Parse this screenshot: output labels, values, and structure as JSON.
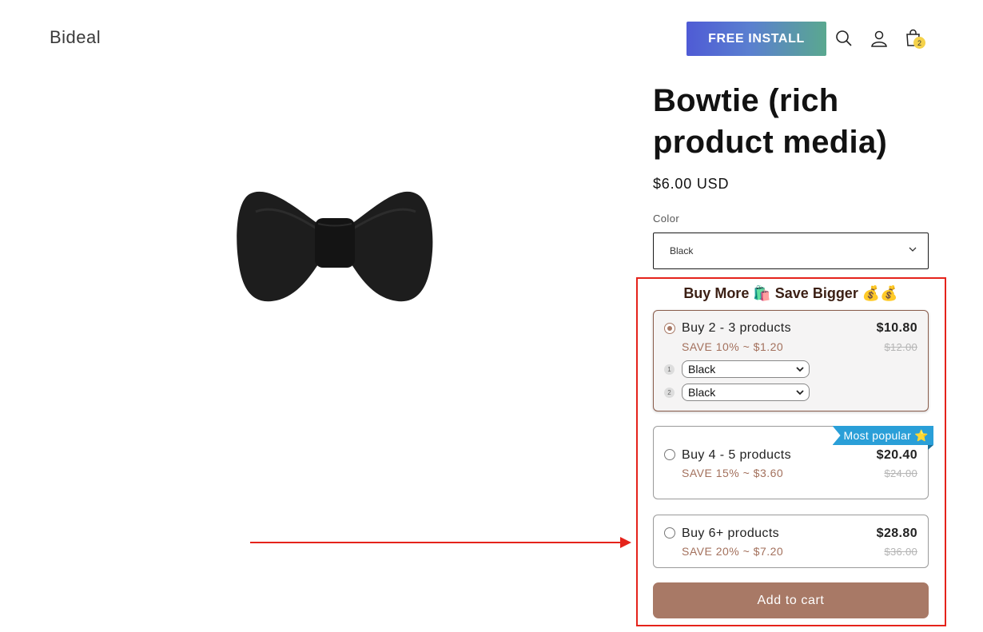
{
  "header": {
    "logo": "Bideal",
    "install_label": "FREE INSTALL",
    "cart_count": "2",
    "icons": [
      "search-icon",
      "account-icon",
      "cart-icon"
    ]
  },
  "product": {
    "title": "Bowtie (rich product media)",
    "price": "$6.00 USD",
    "color_label": "Color",
    "color_value": "Black",
    "image": "black-bowtie"
  },
  "bundle": {
    "heading": "Buy More",
    "heading_mid": "Save Bigger",
    "heading_emoji_1": "🛍️",
    "heading_emoji_2": "💰💰",
    "tiers": [
      {
        "name": "Buy 2 - 3 products",
        "save": "SAVE 10% ~ $1.20",
        "price": "$10.80",
        "compare": "$12.00",
        "selected": true,
        "variants": [
          {
            "num": "1",
            "value": "Black"
          },
          {
            "num": "2",
            "value": "Black"
          }
        ]
      },
      {
        "name": "Buy 4 - 5 products",
        "save": "SAVE 15% ~ $3.60",
        "price": "$20.40",
        "compare": "$24.00",
        "badge": "Most popular ⭐",
        "selected": false
      },
      {
        "name": "Buy 6+ products",
        "save": "SAVE 20% ~ $7.20",
        "price": "$28.80",
        "compare": "$36.00",
        "selected": false
      }
    ]
  },
  "cart_button": "Add to cart",
  "colors": {
    "accent": "#a87966",
    "highlight": "#e5231b",
    "badge": "#2a9fd8"
  }
}
